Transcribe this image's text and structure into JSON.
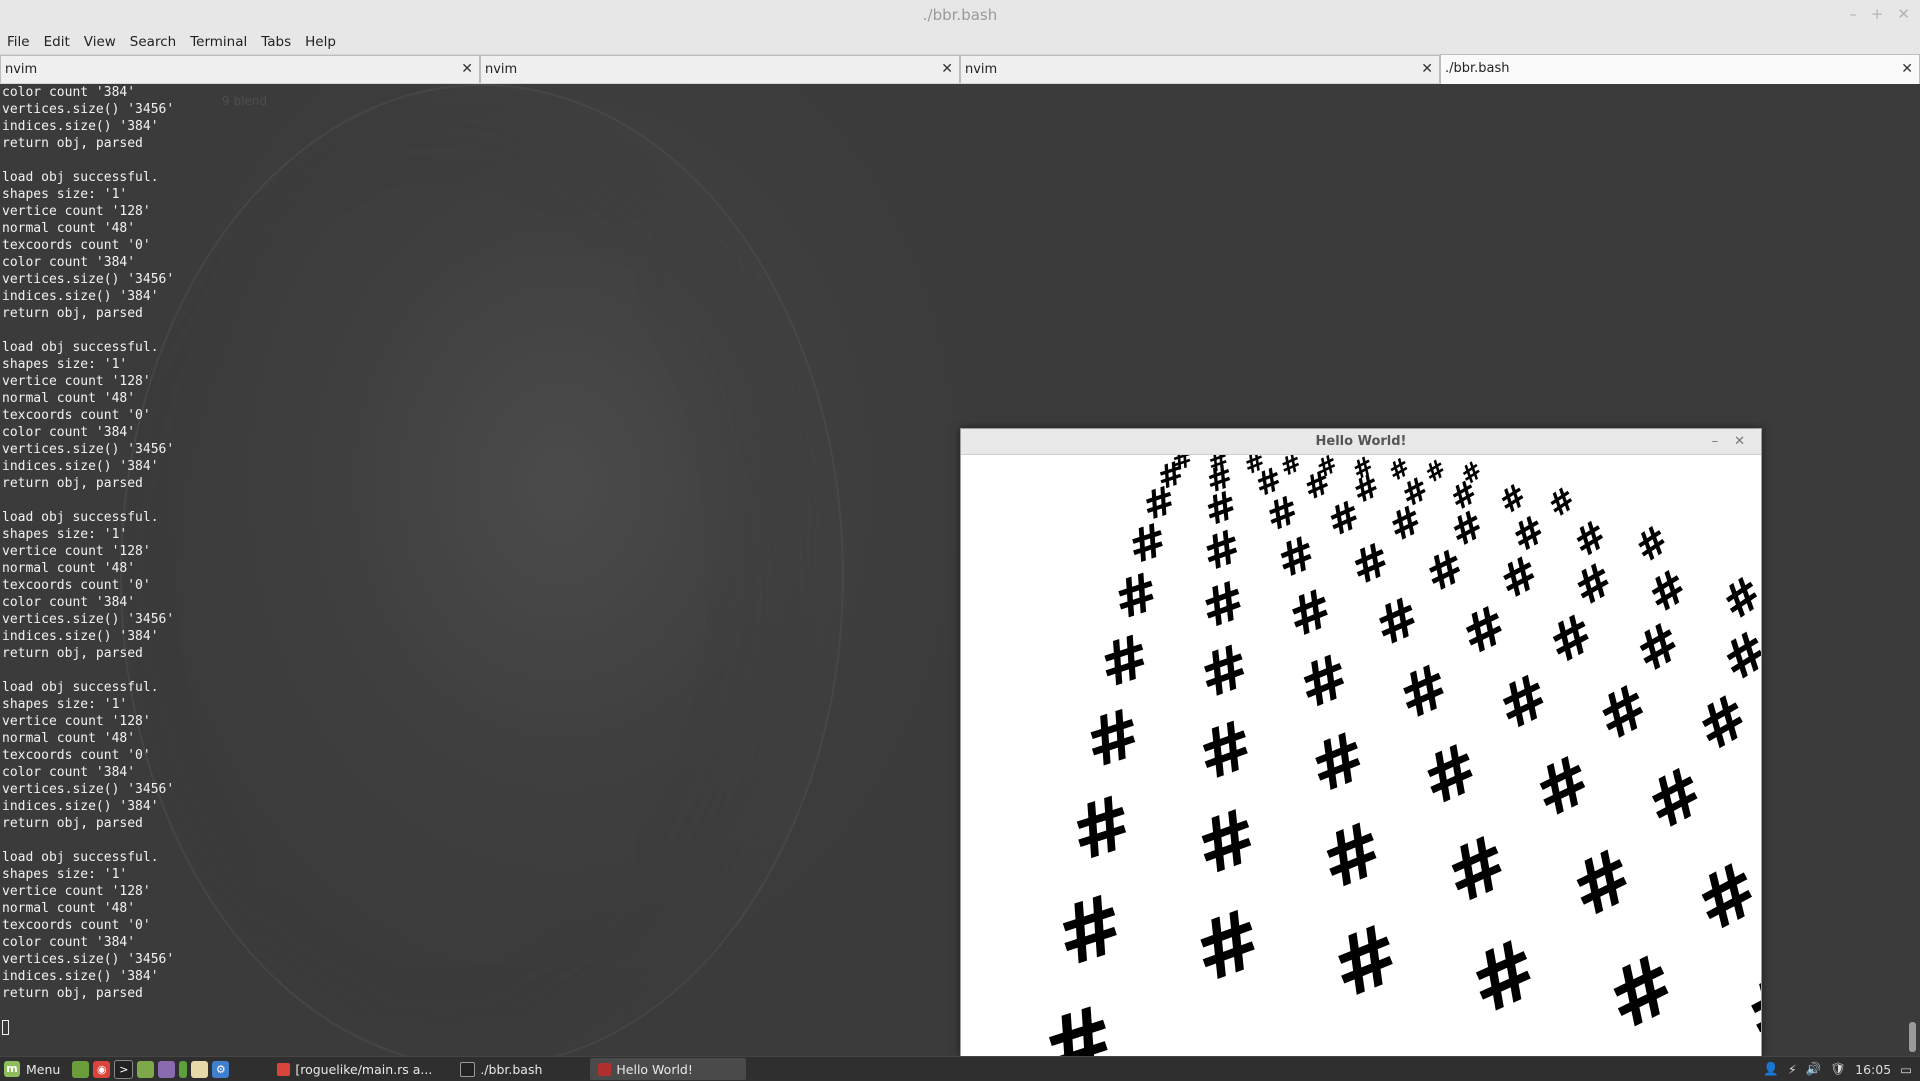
{
  "window": {
    "title": "./bbr.bash",
    "min": "–",
    "max": "+",
    "close": "✕"
  },
  "menubar": [
    "File",
    "Edit",
    "View",
    "Search",
    "Terminal",
    "Tabs",
    "Help"
  ],
  "tabs": [
    {
      "label": "nvim",
      "close": "✕"
    },
    {
      "label": "nvim",
      "close": "✕"
    },
    {
      "label": "nvim",
      "close": "✕"
    },
    {
      "label": "./bbr.bash",
      "close": "✕"
    }
  ],
  "terminal": {
    "background_text": "9 blend",
    "lines": [
      "color count '384'",
      "vertices.size() '3456'",
      "indices.size() '384'",
      "return obj, parsed",
      "",
      "load obj successful.",
      "shapes size: '1'",
      "vertice count '128'",
      "normal count '48'",
      "texcoords count '0'",
      "color count '384'",
      "vertices.size() '3456'",
      "indices.size() '384'",
      "return obj, parsed",
      "",
      "load obj successful.",
      "shapes size: '1'",
      "vertice count '128'",
      "normal count '48'",
      "texcoords count '0'",
      "color count '384'",
      "vertices.size() '3456'",
      "indices.size() '384'",
      "return obj, parsed",
      "",
      "load obj successful.",
      "shapes size: '1'",
      "vertice count '128'",
      "normal count '48'",
      "texcoords count '0'",
      "color count '384'",
      "vertices.size() '3456'",
      "indices.size() '384'",
      "return obj, parsed",
      "",
      "load obj successful.",
      "shapes size: '1'",
      "vertice count '128'",
      "normal count '48'",
      "texcoords count '0'",
      "color count '384'",
      "vertices.size() '3456'",
      "indices.size() '384'",
      "return obj, parsed",
      "",
      "load obj successful.",
      "shapes size: '1'",
      "vertice count '128'",
      "normal count '48'",
      "texcoords count '0'",
      "color count '384'",
      "vertices.size() '3456'",
      "indices.size() '384'",
      "return obj, parsed"
    ]
  },
  "hello_window": {
    "title": "Hello World!",
    "min": "–",
    "close": "✕",
    "glyph": "#"
  },
  "taskbar": {
    "menu_label": "Menu",
    "launchers": [
      "show-desktop-icon",
      "chrome-icon",
      "terminal-icon",
      "files-icon",
      "image-viewer-icon",
      "battery-app-icon",
      "text-editor-icon",
      "settings-icon"
    ],
    "items": [
      {
        "label": "[roguelike/main.rs a...",
        "icon": "chrome-icon",
        "active": false
      },
      {
        "label": "./bbr.bash",
        "icon": "terminal-icon",
        "active": false
      },
      {
        "label": "Hello World!",
        "icon": "app-window-icon",
        "active": true
      }
    ],
    "clock": "16:05"
  },
  "colors": {
    "terminal_bg": "#3e3e3e",
    "terminal_text": "#f2f2f2",
    "taskbar_bg": "#2f2f2f",
    "mint_green": "#8fbc5c"
  }
}
